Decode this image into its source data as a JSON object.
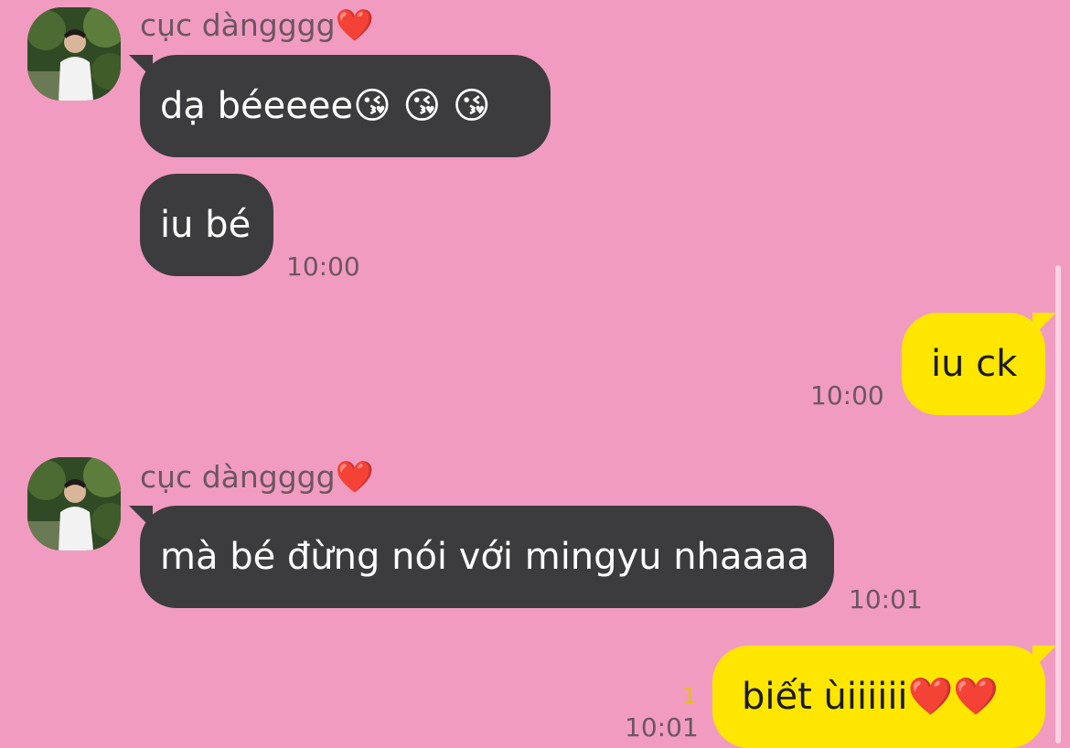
{
  "messages": [
    {
      "direction": "in",
      "sender": "cục dàngggg",
      "sender_emoji": "❤️",
      "text": "dạ béeeee",
      "emoji": "😘 😘 😘"
    },
    {
      "direction": "in",
      "text": "iu bé",
      "time": "10:00"
    },
    {
      "direction": "out",
      "text": "iu ck",
      "time": "10:00"
    },
    {
      "direction": "in",
      "sender": "cục dàngggg",
      "sender_emoji": "❤️",
      "text": "mà bé đừng nói với mingyu nhaaaa",
      "time": "10:01"
    },
    {
      "direction": "out",
      "text": "biết ùiiiiii",
      "emoji": "❤️❤️",
      "time": "10:01",
      "unread_count": "1"
    }
  ],
  "colors": {
    "background": "#f29bc1",
    "incoming_bubble": "#3c3c3e",
    "outgoing_bubble": "#ffe600",
    "unread_indicator": "#e0c400"
  }
}
